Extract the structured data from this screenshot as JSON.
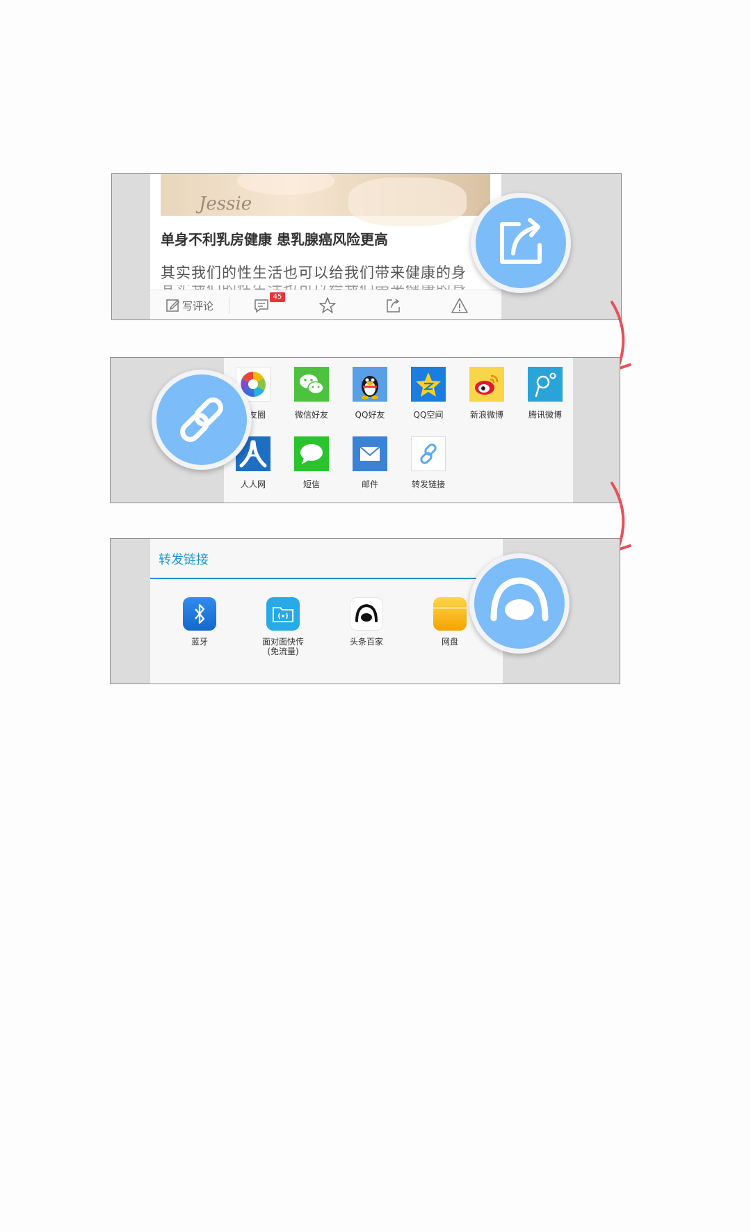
{
  "panel1": {
    "photo_signature": "Jessie",
    "article_title": "单身不利乳房健康 患乳腺癌风险更高",
    "article_excerpt": "其实我们的性生活也可以给我们带来健康的身",
    "toolbar": {
      "write_comment_label": "写评论",
      "comment_count": "45"
    }
  },
  "panel2": {
    "share_items": [
      {
        "label": "朋友圈",
        "icon": "moments-icon"
      },
      {
        "label": "微信好友",
        "icon": "wechat-icon"
      },
      {
        "label": "QQ好友",
        "icon": "qq-icon"
      },
      {
        "label": "QQ空间",
        "icon": "qzone-icon"
      },
      {
        "label": "新浪微博",
        "icon": "sina-weibo-icon"
      },
      {
        "label": "腾讯微博",
        "icon": "tencent-weibo-icon"
      },
      {
        "label": "人人网",
        "icon": "renren-icon"
      },
      {
        "label": "短信",
        "icon": "sms-icon"
      },
      {
        "label": "邮件",
        "icon": "mail-icon"
      },
      {
        "label": "转发链接",
        "icon": "link-icon"
      }
    ]
  },
  "panel3": {
    "sheet_title": "转发链接",
    "targets": [
      {
        "label": "蓝牙",
        "icon": "bluetooth-icon"
      },
      {
        "label": "面对面快传\n(免流量)",
        "icon": "face-to-face-icon"
      },
      {
        "label": "头条百家",
        "icon": "toutiao-baijia-icon"
      },
      {
        "label": "网盘",
        "icon": "cloud-drive-icon"
      }
    ]
  },
  "colors": {
    "highlight_circle": "#7bbcf9",
    "arrow": "#e8505b",
    "accent": "#1a98c9"
  }
}
